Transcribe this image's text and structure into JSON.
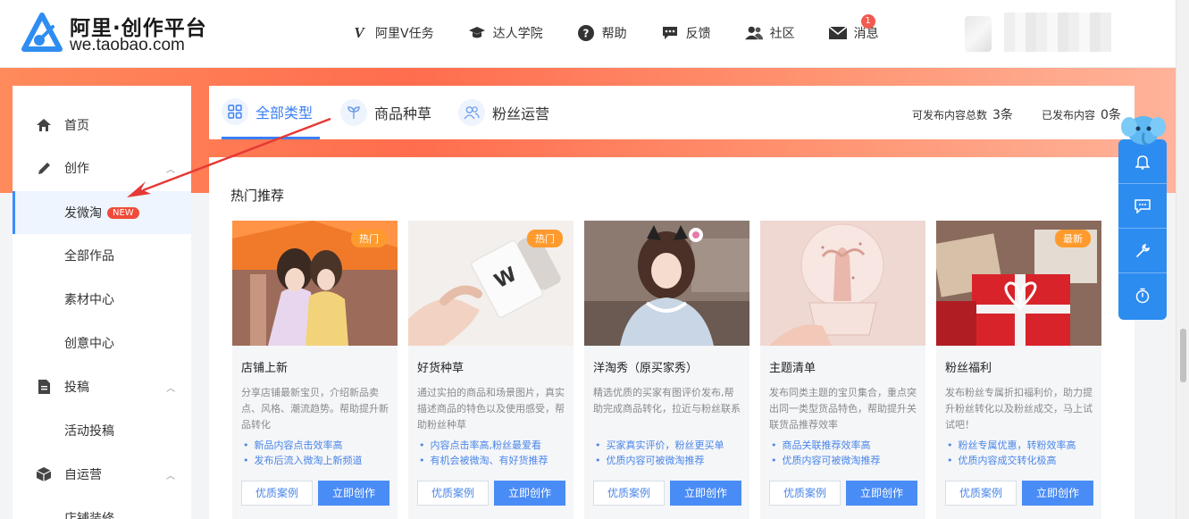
{
  "header": {
    "logo_title": "阿里·创作平台",
    "logo_sub": "we.taobao.com",
    "nav": [
      {
        "label": "阿里V任务",
        "icon": "v-icon"
      },
      {
        "label": "达人学院",
        "icon": "graduation-cap-icon"
      },
      {
        "label": "帮助",
        "icon": "help-icon"
      },
      {
        "label": "反馈",
        "icon": "feedback-icon"
      },
      {
        "label": "社区",
        "icon": "community-icon"
      },
      {
        "label": "消息",
        "icon": "mail-icon",
        "badge": "1"
      }
    ]
  },
  "sidebar": {
    "items": [
      {
        "label": "首页",
        "icon": "home-icon"
      },
      {
        "label": "创作",
        "icon": "pencil-icon"
      },
      {
        "label": "发微淘",
        "badge": "NEW"
      },
      {
        "label": "全部作品"
      },
      {
        "label": "素材中心"
      },
      {
        "label": "创意中心"
      },
      {
        "label": "投稿",
        "icon": "document-icon"
      },
      {
        "label": "活动投稿"
      },
      {
        "label": "自运营",
        "icon": "box-icon"
      },
      {
        "label": "店铺装修"
      }
    ]
  },
  "tabs": [
    {
      "label": "全部类型",
      "icon": "grid-icon"
    },
    {
      "label": "商品种草",
      "icon": "sprout-icon"
    },
    {
      "label": "粉丝运营",
      "icon": "users-icon"
    }
  ],
  "stats": {
    "publishable_label": "可发布内容总数",
    "publishable_value": "3条",
    "published_label": "已发布内容",
    "published_value": "0条"
  },
  "section_title": "热门推荐",
  "cards": [
    {
      "title": "店铺上新",
      "tag": "热门",
      "desc": "分享店铺最新宝贝，介绍新品卖点、风格、潮流趋势。帮助提升新品转化",
      "bullets": [
        "新品内容点击效率高",
        "发布后流入微淘上新频道"
      ],
      "case_label": "优质案例",
      "create_label": "立即创作"
    },
    {
      "title": "好货种草",
      "tag": "热门",
      "desc": "通过实拍的商品和场景图片，真实描述商品的特色以及使用感受，帮助粉丝种草",
      "bullets": [
        "内容点击率高,粉丝最爱看",
        "有机会被微淘、有好货推荐"
      ],
      "case_label": "优质案例",
      "create_label": "立即创作"
    },
    {
      "title": "洋淘秀（原买家秀）",
      "tag": "",
      "desc": "精选优质的买家有图评价发布,帮助完成商品转化，拉近与粉丝联系",
      "bullets": [
        "买家真实评价，粉丝更买单",
        "优质内容可被微淘推荐"
      ],
      "case_label": "优质案例",
      "create_label": "立即创作"
    },
    {
      "title": "主题清单",
      "tag": "",
      "desc": "发布同类主题的宝贝集合，重点突出同一类型货品特色，帮助提升关联货品推荐效率",
      "bullets": [
        "商品关联推荐效率高",
        "优质内容可被微淘推荐"
      ],
      "case_label": "优质案例",
      "create_label": "立即创作"
    },
    {
      "title": "粉丝福利",
      "tag": "最新",
      "desc": "发布粉丝专属折扣福利价，助力提升粉丝转化以及粉丝成交，马上试试吧！",
      "bullets": [
        "粉丝专属优惠，转粉效率高",
        "优质内容成交转化极高"
      ],
      "case_label": "优质案例",
      "create_label": "立即创作"
    }
  ],
  "float_bar": [
    "bell-icon",
    "message-icon",
    "wrench-icon",
    "timer-icon"
  ],
  "colors": {
    "accent": "#3b7ff5",
    "tag": "#ff9a2e",
    "badge": "#f04b3a",
    "banner": "#ff6d4d",
    "float_bar": "#2d8cf0"
  }
}
